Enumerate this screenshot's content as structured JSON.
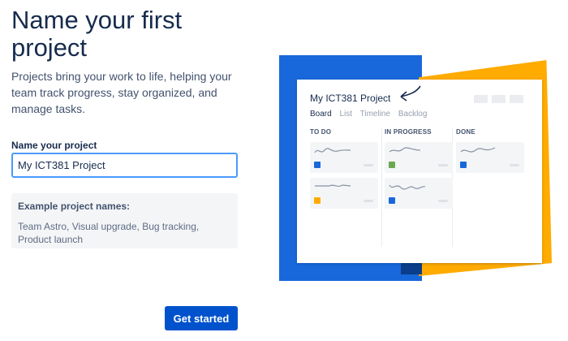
{
  "page": {
    "title": "Name your first project",
    "subtitle": "Projects bring your work to life, helping your team track progress, stay organized, and manage tasks."
  },
  "form": {
    "label": "Name your project",
    "value": "My ICT381 Project"
  },
  "examples": {
    "title": "Example project names:",
    "text": "Team Astro, Visual upgrade, Bug tracking, Product launch"
  },
  "actions": {
    "get_started_label": "Get started"
  },
  "preview": {
    "project_name": "My ICT381 Project",
    "tabs": [
      "Board",
      "List",
      "Timeline",
      "Backlog"
    ],
    "columns": [
      {
        "name": "TO DO",
        "task_colors": [
          "#1868db",
          "#ffab00"
        ]
      },
      {
        "name": "IN PROGRESS",
        "task_colors": [
          "#6aa84f",
          "#1868db"
        ]
      },
      {
        "name": "DONE",
        "task_colors": [
          "#1868db"
        ]
      }
    ],
    "colors": {
      "blue": "#1868db",
      "yellow": "#ffab00",
      "accent_button": "#0052cc"
    },
    "icons": [
      "arrow-icon"
    ]
  }
}
